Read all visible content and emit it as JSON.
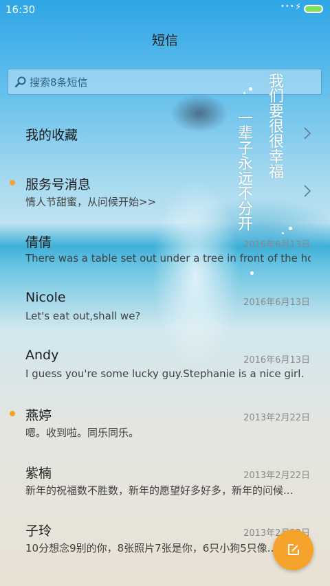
{
  "status_bar": {
    "time": "16:30",
    "signal": "•••"
  },
  "header": {
    "title": "短信"
  },
  "search": {
    "placeholder": "搜索8条短信"
  },
  "wallpaper_text": {
    "line1": "我们要很很幸福",
    "line2": "一辈子永远不分开"
  },
  "conversations": [
    {
      "name": "我的收藏",
      "preview": "",
      "date": "",
      "unread": false,
      "chevron": true
    },
    {
      "name": "服务号消息",
      "preview": "情人节甜蜜，从问候开始>>",
      "date": "",
      "unread": true,
      "chevron": true
    },
    {
      "name": "倩倩",
      "preview": "There was a table set out under a tree in front of the ho...",
      "date": "2016年6月13日",
      "unread": false,
      "chevron": false
    },
    {
      "name": "Nicole",
      "preview": "Let's eat out,shall we?",
      "date": "2016年6月13日",
      "unread": false,
      "chevron": false
    },
    {
      "name": "Andy",
      "preview": "I guess you're some lucky guy.Stephanie is a nice girl.",
      "date": "2016年6月13日",
      "unread": false,
      "chevron": false
    },
    {
      "name": "燕婷",
      "preview": "嗯。收到啦。同乐同乐。",
      "date": "2013年2月22日",
      "unread": true,
      "chevron": false
    },
    {
      "name": "紫楠",
      "preview": "新年的祝福数不胜数，新年的愿望好多好多，新年的问候...",
      "date": "2013年2月22日",
      "unread": false,
      "chevron": false
    },
    {
      "name": "子玲",
      "preview": "10分想念9别的你，8张照片7张是你，6只小狗5只像...",
      "date": "2013年2月22日",
      "unread": false,
      "chevron": false
    }
  ],
  "colors": {
    "accent": "#f5a32b",
    "unread_dot": "#f4a22b",
    "battery": "#7ee25d"
  },
  "icons": {
    "search": "search-icon",
    "chevron": "chevron-right-icon",
    "compose": "compose-icon"
  }
}
